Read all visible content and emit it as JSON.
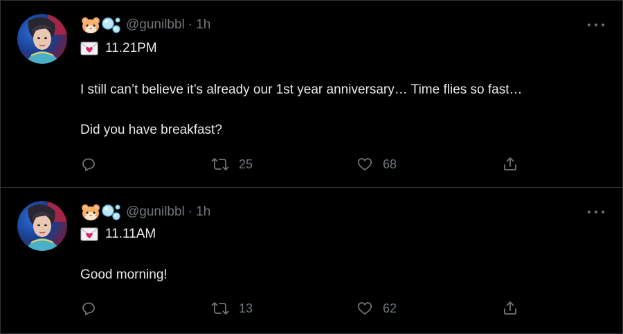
{
  "colors": {
    "background": "#000000",
    "text_primary": "#e7e9ea",
    "text_secondary": "#71767b",
    "divider": "#2f3336"
  },
  "tweets": [
    {
      "handle": "@gunilbbl",
      "separator": "·",
      "time": "1h",
      "badge_icons": [
        "hamster-face-emoji",
        "bubbles-emoji"
      ],
      "mail_icon": "love-letter-emoji",
      "mail_time": "11.21PM",
      "lines": [
        "I still can’t believe it’s already our 1st year anniversary… Time flies so fast…",
        "Did you have breakfast?"
      ],
      "actions": {
        "reply_count": "",
        "retweet_count": "25",
        "like_count": "68"
      }
    },
    {
      "handle": "@gunilbbl",
      "separator": "·",
      "time": "1h",
      "badge_icons": [
        "hamster-face-emoji",
        "bubbles-emoji"
      ],
      "mail_icon": "love-letter-emoji",
      "mail_time": "11.11AM",
      "lines": [
        "Good morning!"
      ],
      "actions": {
        "reply_count": "",
        "retweet_count": "13",
        "like_count": "62"
      }
    }
  ]
}
